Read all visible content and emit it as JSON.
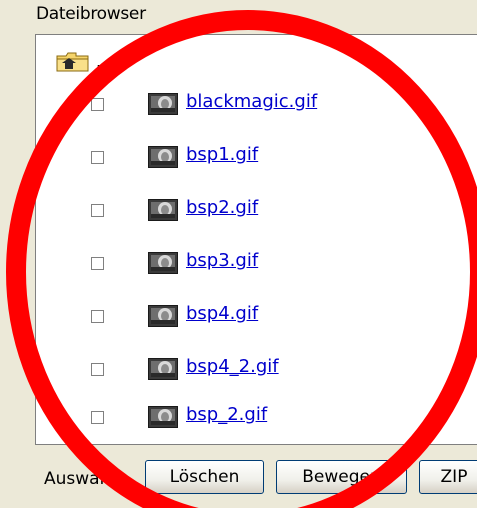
{
  "header": {
    "title": "Dateibrowser"
  },
  "browser": {
    "up_label": "..",
    "files": [
      {
        "name": "blackmagic.gif"
      },
      {
        "name": "bsp1.gif"
      },
      {
        "name": "bsp2.gif"
      },
      {
        "name": "bsp3.gif"
      },
      {
        "name": "bsp4.gif"
      },
      {
        "name": "bsp4_2.gif"
      },
      {
        "name": "bsp_2.gif"
      }
    ]
  },
  "actions": {
    "label": "Auswahl:",
    "delete_label": "Löschen",
    "move_label": "Bewegen",
    "zip_label": "ZIP"
  },
  "annotation": {
    "color": "#FF0000"
  },
  "icons": {
    "up": "folder-up-icon",
    "thumbnail": "image-thumbnail-icon"
  }
}
